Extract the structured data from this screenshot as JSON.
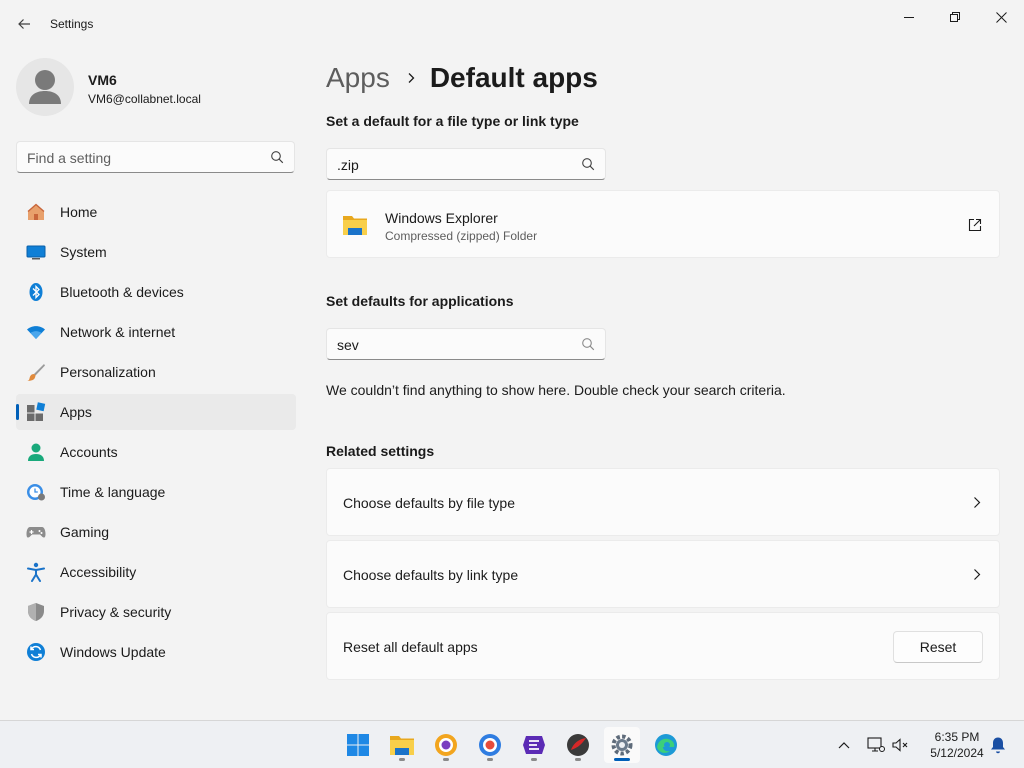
{
  "window": {
    "title": "Settings"
  },
  "user": {
    "name": "VM6",
    "email": "VM6@collabnet.local"
  },
  "sidebar": {
    "search_placeholder": "Find a setting",
    "items": [
      {
        "label": "Home",
        "icon": "home-icon"
      },
      {
        "label": "System",
        "icon": "system-icon"
      },
      {
        "label": "Bluetooth & devices",
        "icon": "bluetooth-icon"
      },
      {
        "label": "Network & internet",
        "icon": "wifi-icon"
      },
      {
        "label": "Personalization",
        "icon": "brush-icon"
      },
      {
        "label": "Apps",
        "icon": "apps-icon",
        "active": true
      },
      {
        "label": "Accounts",
        "icon": "accounts-icon"
      },
      {
        "label": "Time & language",
        "icon": "clock-globe-icon"
      },
      {
        "label": "Gaming",
        "icon": "gamepad-icon"
      },
      {
        "label": "Accessibility",
        "icon": "accessibility-icon"
      },
      {
        "label": "Privacy & security",
        "icon": "shield-icon"
      },
      {
        "label": "Windows Update",
        "icon": "update-icon"
      }
    ]
  },
  "breadcrumb": {
    "parent": "Apps",
    "current": "Default apps"
  },
  "file_type": {
    "heading": "Set a default for a file type or link type",
    "search_value": ".zip",
    "result": {
      "app_name": "Windows Explorer",
      "description": "Compressed (zipped) Folder"
    }
  },
  "applications": {
    "heading": "Set defaults for applications",
    "search_value": "sev",
    "empty_message": "We couldn’t find anything to show here. Double check your search criteria."
  },
  "related": {
    "heading": "Related settings",
    "items": [
      {
        "label": "Choose defaults by file type"
      },
      {
        "label": "Choose defaults by link type"
      }
    ],
    "reset": {
      "label": "Reset all default apps",
      "button": "Reset"
    }
  },
  "taskbar": {
    "time": "6:35 PM",
    "date": "5/12/2024"
  },
  "colors": {
    "accent": "#005fb8",
    "background": "#f3f3f3",
    "card": "#fbfbfb"
  }
}
